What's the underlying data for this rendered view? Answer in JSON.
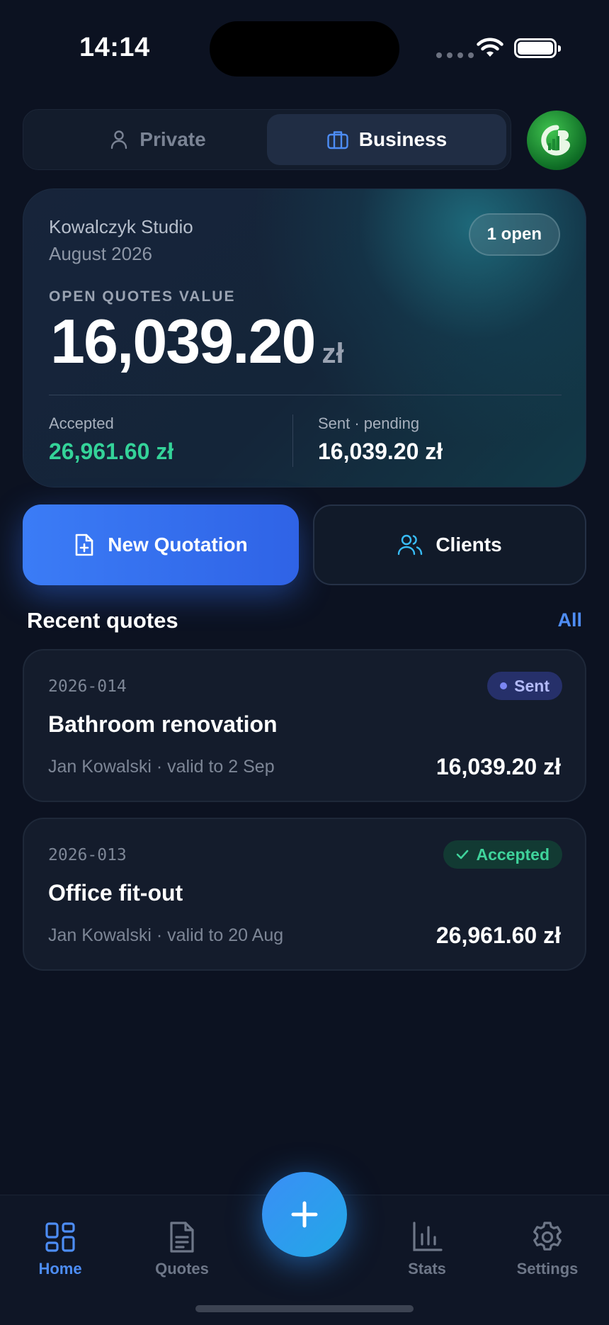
{
  "status_bar": {
    "time": "14:14"
  },
  "mode_switch": {
    "private_label": "Private",
    "business_label": "Business",
    "selected": "Business"
  },
  "summary": {
    "company": "Kowalczyk Studio",
    "period": "August 2026",
    "open_badge": "1 open",
    "open_label": "OPEN QUOTES VALUE",
    "open_value": "16,039.20",
    "currency": "zł",
    "accepted_label": "Accepted",
    "accepted_value": "26,961.60 zł",
    "sent_label": "Sent · pending",
    "sent_value": "16,039.20 zł"
  },
  "actions": {
    "new_quotation": "New Quotation",
    "clients": "Clients"
  },
  "recent": {
    "title": "Recent quotes",
    "all_link": "All",
    "quotes": [
      {
        "number": "2026-014",
        "title": "Bathroom renovation",
        "subtitle": "Jan Kowalski · valid to 2 Sep",
        "amount": "16,039.20 zł",
        "status": "Sent"
      },
      {
        "number": "2026-013",
        "title": "Office fit-out",
        "subtitle": "Jan Kowalski · valid to 20 Aug",
        "amount": "26,961.60 zł",
        "status": "Accepted"
      }
    ]
  },
  "tabbar": {
    "home": "Home",
    "quotes": "Quotes",
    "stats": "Stats",
    "settings": "Settings",
    "active": "Home"
  },
  "colors": {
    "accent": "#4d8df5",
    "accepted": "#34d399",
    "sent_badge": "#b3baf8",
    "background": "#0c1221"
  }
}
